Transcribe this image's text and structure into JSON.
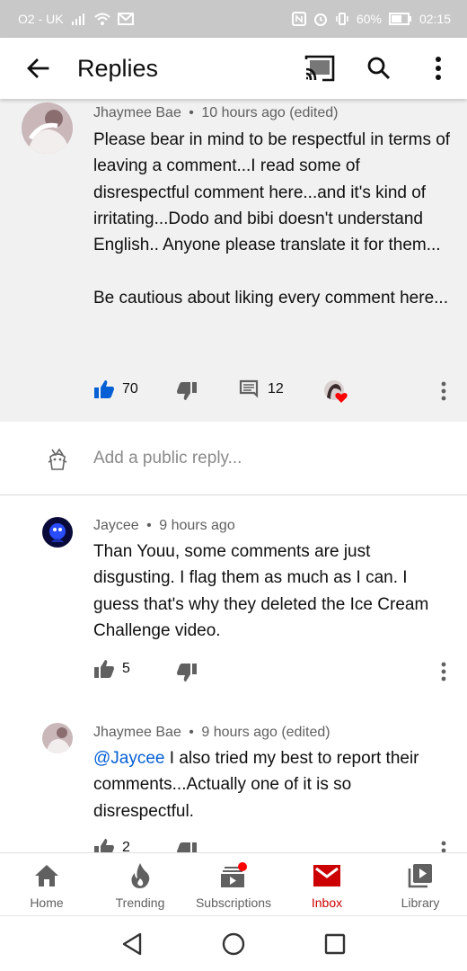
{
  "status_bar": {
    "carrier": "O2 - UK",
    "battery": "60%",
    "time": "02:15"
  },
  "header": {
    "title": "Replies",
    "icons": [
      "back-arrow-icon",
      "cast-icon",
      "search-icon",
      "more-vert-icon"
    ]
  },
  "parent_comment": {
    "author": "Jhaymee Bae",
    "separator": "•",
    "time": "10 hours ago (edited)",
    "text": "Please bear in mind to be respectful in terms of leaving a comment...I read some of disrespectful comment here...and it's kind of irritating...Dodo and bibi  doesn't understand English.. Anyone please translate it for them...\n\nBe cautious about liking every  comment here...",
    "likes": "70",
    "replies": "12"
  },
  "reply_input": {
    "placeholder": "Add a public reply..."
  },
  "replies": [
    {
      "author": "Jaycee",
      "separator": "•",
      "time": "9 hours ago",
      "text": "Than Youu, some comments are just disgusting. I flag them as much as I can. I guess that's why they deleted the Ice Cream Challenge video.",
      "likes": "5"
    },
    {
      "author": "Jhaymee Bae",
      "separator": "•",
      "time": "9 hours ago (edited)",
      "mention": "@Jaycee",
      "text": " I also tried my best to report their comments...Actually one of it is so disrespectful.",
      "likes": "2"
    }
  ],
  "bottom_nav": {
    "items": [
      {
        "label": "Home",
        "icon": "home-icon"
      },
      {
        "label": "Trending",
        "icon": "trending-flame-icon"
      },
      {
        "label": "Subscriptions",
        "icon": "subscriptions-icon"
      },
      {
        "label": "Inbox",
        "icon": "inbox-mail-icon",
        "active": true
      },
      {
        "label": "Library",
        "icon": "library-icon"
      }
    ]
  },
  "colors": {
    "accent_blue": "#065fd4",
    "youtube_red": "#cc0000",
    "highlight_bg": "#f1f1f1",
    "text_primary": "#0f0f0f",
    "text_secondary": "#606060"
  }
}
